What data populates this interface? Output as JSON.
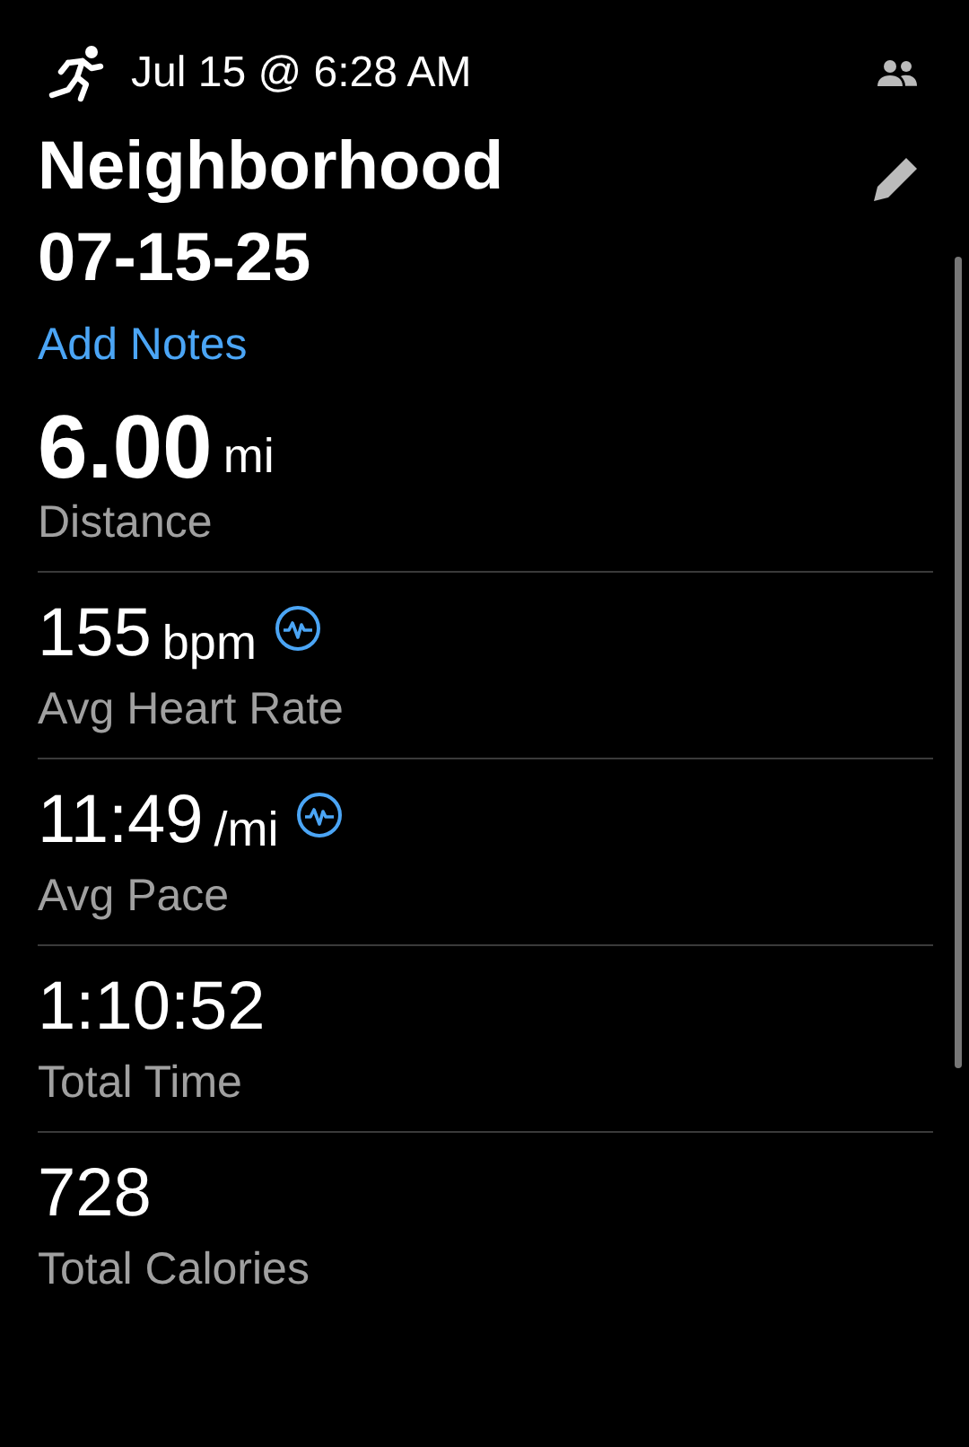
{
  "header": {
    "datetime": "Jul 15 @ 6:28 AM"
  },
  "title": "Neighborhood 07-15-25",
  "notes_link": "Add Notes",
  "stats": [
    {
      "kind": "primary",
      "value": "6.00",
      "unit": "mi",
      "label": "Distance",
      "has_graph": false
    },
    {
      "kind": "regular",
      "value": "155",
      "unit": "bpm",
      "label": "Avg Heart Rate",
      "has_graph": true
    },
    {
      "kind": "regular",
      "value": "11:49",
      "unit": "/mi",
      "label": "Avg Pace",
      "has_graph": true
    },
    {
      "kind": "regular",
      "value": "1:10:52",
      "label": "Total Time",
      "has_graph": false
    },
    {
      "kind": "regular",
      "value": "728",
      "label": "Total Calories",
      "has_graph": false
    }
  ]
}
